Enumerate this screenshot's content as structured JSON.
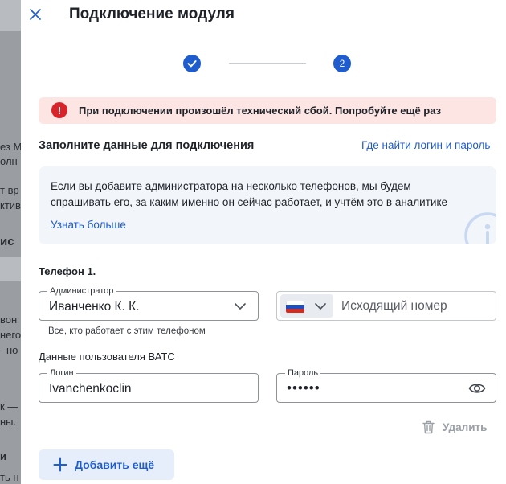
{
  "modal": {
    "title": "Подключение модуля",
    "steps": [
      {
        "state": "done",
        "label": ""
      },
      {
        "state": "current",
        "label": "2"
      }
    ]
  },
  "alert": {
    "text": "При подключении произошёл технический сбой. Попробуйте ещё раз",
    "icon": "exclamation-icon",
    "color": "#d8232a"
  },
  "section": {
    "title": "Заполните данные для подключения",
    "help_link": "Где найти логин и пароль"
  },
  "info": {
    "text": "Если вы добавите администратора на несколько телефонов, мы будем спрашивать его, за каким именно он сейчас работает, и учтём это в аналитике",
    "link": "Узнать больше"
  },
  "phone": {
    "title": "Телефон 1.",
    "admin_label": "Администратор",
    "admin_value": "Иванченко К. К.",
    "admin_hint": "Все, кто работает с этим телефоном",
    "outgoing_placeholder": "Исходящий номер",
    "country_flag": "ru-flag-icon"
  },
  "vats": {
    "title": "Данные пользователя ВАТС",
    "login_label": "Логин",
    "login_value": "Ivanchenkoclin",
    "password_label": "Пароль",
    "password_value": "••••••"
  },
  "actions": {
    "delete_label": "Удалить",
    "add_label": "Добавить ещё"
  },
  "backdrop": {
    "fragments": [
      "ез М",
      "олн",
      "т вр",
      "ктив",
      "иc",
      "вон",
      "него",
      "- но",
      "к —",
      "ны.",
      "и",
      "ть н"
    ]
  },
  "colors": {
    "accent": "#1f5ccd",
    "alert_bg": "#fde5e3",
    "info_bg": "#f2f5fa",
    "add_bg": "#e7eefb"
  }
}
